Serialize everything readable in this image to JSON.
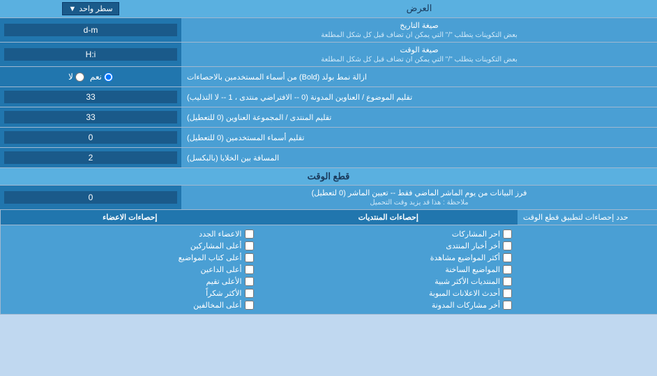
{
  "header": {
    "label": "العرض",
    "dropdown_label": "سطر واحد",
    "dropdown_arrow": "▼"
  },
  "rows": [
    {
      "id": "date_format",
      "label": "صيغة التاريخ",
      "sublabel": "بعض التكوينات يتطلب \"/\" التي يمكن ان تضاف قبل كل شكل المطلعة",
      "input_value": "d-m",
      "has_input": true,
      "has_radio": false
    },
    {
      "id": "time_format",
      "label": "صيغة الوقت",
      "sublabel": "بعض التكوينات يتطلب \"/\" التي يمكن ان تضاف قبل كل شكل المطلعة",
      "input_value": "H:i",
      "has_input": true,
      "has_radio": false
    },
    {
      "id": "bold_remove",
      "label": "ازالة نمط بولد (Bold) من أسماء المستخدمين بالاحصاءات",
      "sublabel": "",
      "input_value": "",
      "has_input": false,
      "has_radio": true,
      "radio_options": [
        "نعم",
        "لا"
      ],
      "radio_default": "نعم"
    },
    {
      "id": "subject_limit",
      "label": "تقليم الموضوع / العناوين المدونة (0 -- الافتراضي منتدى ، 1 -- لا التذليب)",
      "sublabel": "",
      "input_value": "33",
      "has_input": true,
      "has_radio": false
    },
    {
      "id": "forum_header",
      "label": "تقليم المنتدى / المجموعة العناوين (0 للتعطيل)",
      "sublabel": "",
      "input_value": "33",
      "has_input": true,
      "has_radio": false
    },
    {
      "id": "username_trim",
      "label": "تقليم أسماء المستخدمين (0 للتعطيل)",
      "sublabel": "",
      "input_value": "0",
      "has_input": true,
      "has_radio": false
    },
    {
      "id": "cell_spacing",
      "label": "المسافة بين الخلايا (بالبكسل)",
      "sublabel": "",
      "input_value": "2",
      "has_input": true,
      "has_radio": false
    }
  ],
  "section_realtime": {
    "title": "قطع الوقت"
  },
  "row_realtime": {
    "label": "فرز البيانات من يوم الماشر الماضي فقط -- تعيين الماشر (0 لتعطيل)",
    "sublabel": "ملاحظة : هذا قد يزيد وقت التحميل",
    "input_value": "0"
  },
  "checkboxes_section": {
    "limit_label": "حدد إحصاءات لتطبيق قطع الوقت",
    "columns": [
      {
        "id": "col_stats",
        "header": "إحصاءات المنتديات",
        "items": [
          {
            "id": "cb_shares",
            "label": "احر المشاركات",
            "checked": false
          },
          {
            "id": "cb_forum_news",
            "label": "أخر أخبار المنتدى",
            "checked": false
          },
          {
            "id": "cb_most_viewed",
            "label": "أكثر المواضيع مشاهدة",
            "checked": false
          },
          {
            "id": "cb_hot_topics",
            "label": "المواضيع الساخنة",
            "checked": false
          },
          {
            "id": "cb_similar",
            "label": "المنتديات الأكثر شبية",
            "checked": false
          },
          {
            "id": "cb_ads",
            "label": "أحدث الاعلانات المبوبة",
            "checked": false
          },
          {
            "id": "cb_participations",
            "label": "أخر مشاركات المدونة",
            "checked": false
          }
        ]
      },
      {
        "id": "col_members",
        "header": "إحصاءات الاعضاء",
        "items": [
          {
            "id": "cb_new_members",
            "label": "الاعضاء الجدد",
            "checked": false
          },
          {
            "id": "cb_top_posters",
            "label": "أعلى المشاركين",
            "checked": false
          },
          {
            "id": "cb_top_bloggers",
            "label": "أعلى كتاب المواضيع",
            "checked": false
          },
          {
            "id": "cb_top_thanks",
            "label": "أعلى الداعين",
            "checked": false
          },
          {
            "id": "cb_top_rated",
            "label": "الأعلى تقيم",
            "checked": false
          },
          {
            "id": "cb_most_thanks",
            "label": "الأكثر شكراً",
            "checked": false
          },
          {
            "id": "cb_top_neg",
            "label": "أعلى المخالفين",
            "checked": false
          }
        ]
      }
    ]
  }
}
